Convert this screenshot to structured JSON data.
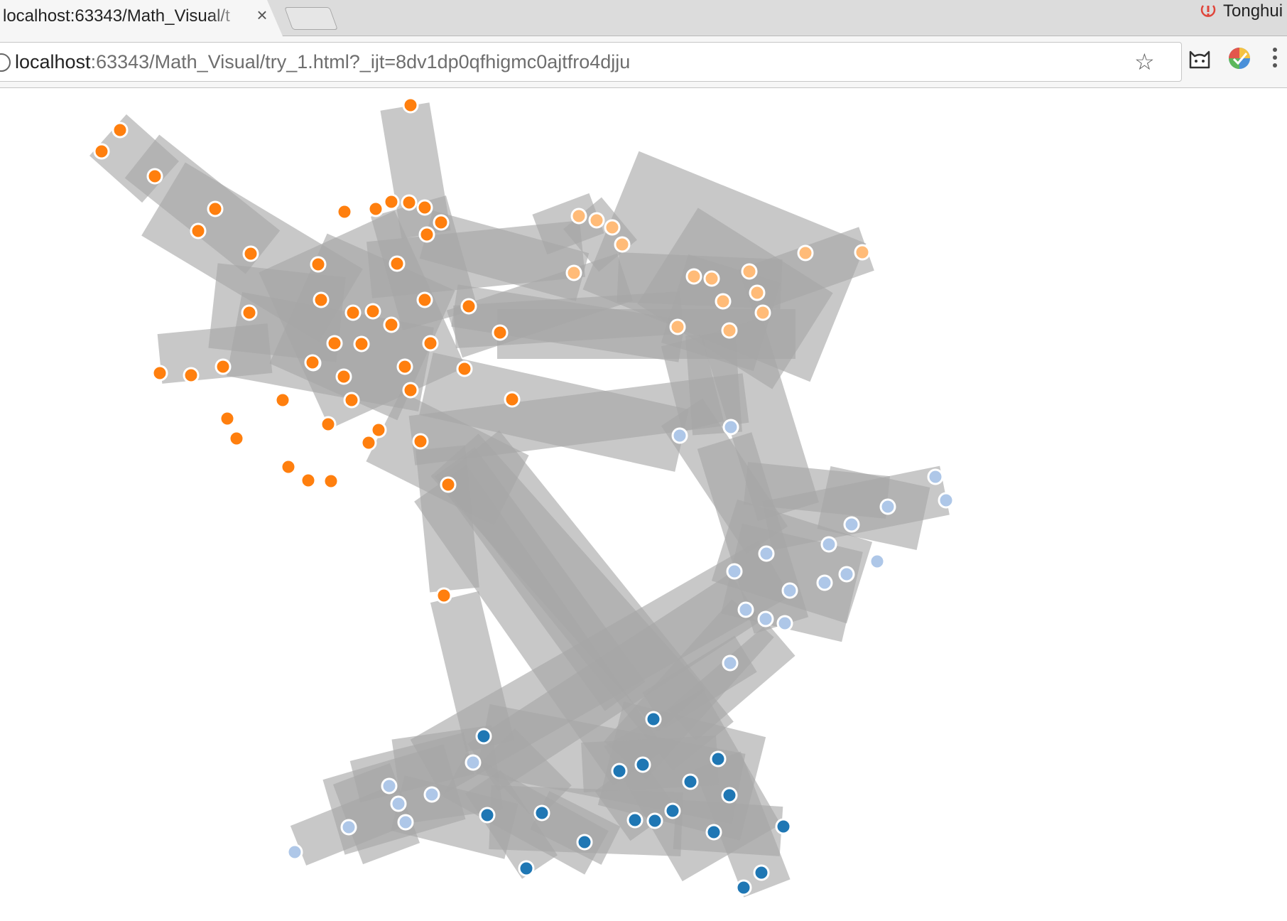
{
  "browser": {
    "tab_title": "localhost:63343/Math_Visual/t",
    "tab_close_glyph": "×",
    "profile_name": "Tonghui",
    "url_host": "localhost",
    "url_rest": ":63343/Math_Visual/try_1.html?_ijt=8dv1dp0qfhigmc0ajtfro4djju",
    "star_glyph": "☆"
  },
  "icons": {
    "info": "info-icon",
    "star": "bookmark-star-icon",
    "cat_extension": "cat-extension-icon",
    "color_extension": "color-picker-extension-icon",
    "menu": "kebab-menu-icon",
    "profile_sync": "sync-error-icon"
  },
  "graph": {
    "colors": {
      "edge": "#a6a6a6",
      "node_stroke": "#ffffff",
      "group_1": "#ff7f0e",
      "group_2": "#ffbb78",
      "group_3": "#aec7e8",
      "group_4": "#1f77b4"
    }
  }
}
